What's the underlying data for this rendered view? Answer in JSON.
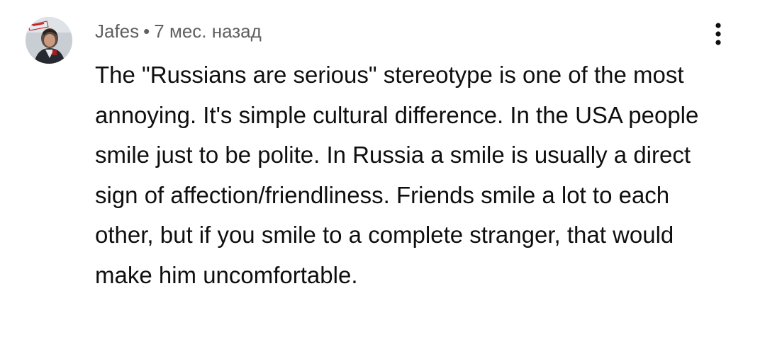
{
  "comment": {
    "author": "Jafes",
    "separator": "•",
    "time": "7 мес. назад",
    "text": "The \"Russians are serious\" stereotype is one of the most annoying. It's simple cultural difference. In the USA people smile just to be polite. In Russia a smile is usually a direct sign of affection/friendliness. Friends smile a lot to each other, but if you smile to a complete stranger, that would make him uncomfortable.",
    "avatar_icon": "user-avatar-photo",
    "menu_icon": "more-vert-icon"
  }
}
